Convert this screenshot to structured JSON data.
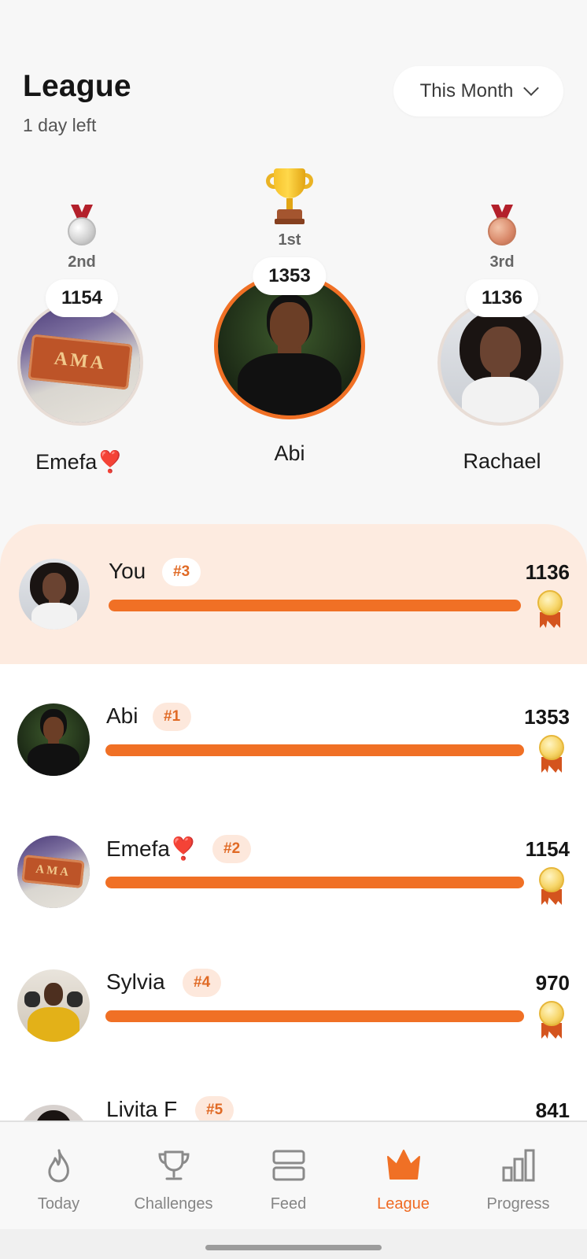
{
  "header": {
    "title": "League",
    "subtitle": "1 day left",
    "period_label": "This Month"
  },
  "podium": {
    "first": {
      "rank": "1st",
      "score": "1353",
      "name": "Abi"
    },
    "second": {
      "rank": "2nd",
      "score": "1154",
      "name": "Emefa❣️"
    },
    "third": {
      "rank": "3rd",
      "score": "1136",
      "name": "Rachael"
    }
  },
  "avatar_text": "AMA",
  "leaderboard": [
    {
      "name": "You",
      "rank": "#3",
      "score": "1136",
      "progress": 1.0
    },
    {
      "name": "Abi",
      "rank": "#1",
      "score": "1353",
      "progress": 1.0
    },
    {
      "name": "Emefa❣️",
      "rank": "#2",
      "score": "1154",
      "progress": 1.0
    },
    {
      "name": "Sylvia",
      "rank": "#4",
      "score": "970",
      "progress": 1.0
    },
    {
      "name": "Livita F",
      "rank": "#5",
      "score": "841",
      "progress": 1.0
    }
  ],
  "tabs": [
    {
      "label": "Today",
      "icon": "flame-icon"
    },
    {
      "label": "Challenges",
      "icon": "trophy-icon"
    },
    {
      "label": "Feed",
      "icon": "feed-icon"
    },
    {
      "label": "League",
      "icon": "crown-icon",
      "active": true
    },
    {
      "label": "Progress",
      "icon": "bar-chart-icon"
    }
  ],
  "colors": {
    "accent": "#f07025",
    "highlight_card": "#fdebe0",
    "rank_badge_bg": "#fde8dc"
  }
}
